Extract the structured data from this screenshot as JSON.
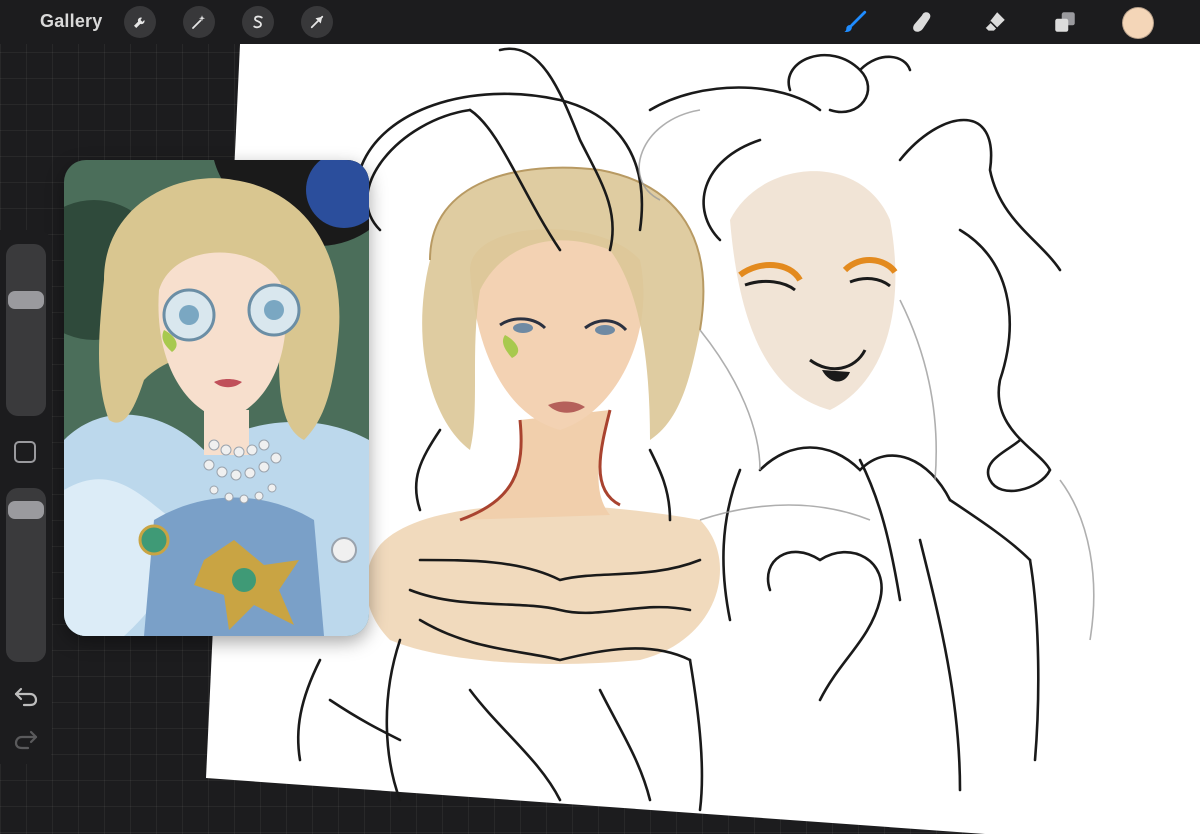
{
  "topbar": {
    "gallery_label": "Gallery",
    "left_tools": [
      {
        "name": "actions",
        "icon": "wrench-icon"
      },
      {
        "name": "adjustments",
        "icon": "magic-wand-icon"
      },
      {
        "name": "selection",
        "icon": "selection-s-icon"
      },
      {
        "name": "transform",
        "icon": "arrow-cursor-icon"
      }
    ],
    "right_tools": [
      {
        "name": "brush",
        "icon": "brush-icon",
        "active": true
      },
      {
        "name": "smudge",
        "icon": "smudge-finger-icon",
        "active": false
      },
      {
        "name": "eraser",
        "icon": "eraser-icon",
        "active": false
      },
      {
        "name": "layers",
        "icon": "layers-icon",
        "active": false
      }
    ],
    "current_color": "#f4d6b8"
  },
  "sidebar": {
    "brush_size_level": 0.3,
    "opacity_level": 0.07
  },
  "colors": {
    "ui_bg": "#1c1c1e",
    "active_tool": "#1f8cff",
    "skin": "#f0cfaa",
    "hair": "#d8bf8a"
  }
}
